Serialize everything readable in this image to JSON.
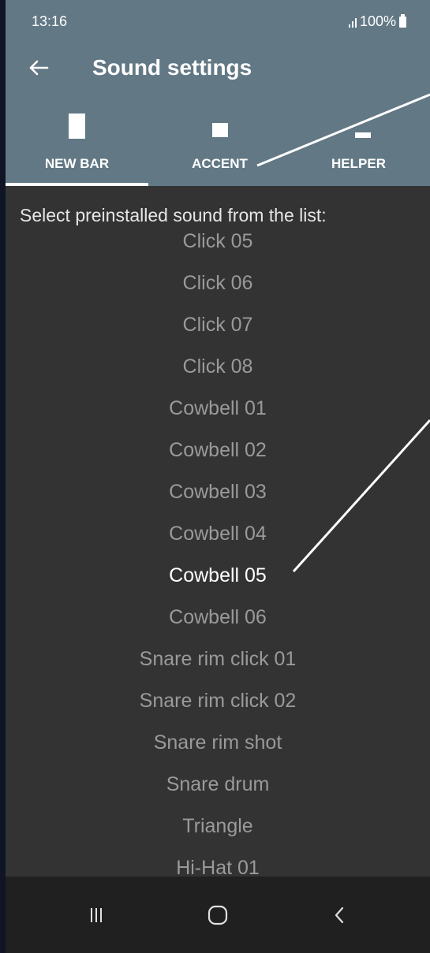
{
  "status_bar": {
    "time": "13:16",
    "battery": "100%"
  },
  "app_bar": {
    "title": "Sound settings",
    "back_icon": "arrow-left-icon"
  },
  "tabs": [
    {
      "label": "NEW BAR",
      "selected": true
    },
    {
      "label": "ACCENT",
      "selected": false
    },
    {
      "label": "HELPER",
      "selected": false
    }
  ],
  "content": {
    "heading": "Select preinstalled sound from the list:",
    "items": [
      "Click 05",
      "Click 06",
      "Click 07",
      "Click 08",
      "Cowbell 01",
      "Cowbell 02",
      "Cowbell 03",
      "Cowbell 04",
      "Cowbell 05",
      "Cowbell 06",
      "Snare rim click 01",
      "Snare rim click 02",
      "Snare rim shot",
      "Snare drum",
      "Triangle",
      "Hi-Hat 01"
    ],
    "selected_item": "Cowbell 05"
  },
  "nav_bar": {
    "recents_icon": "recents-icon",
    "home_icon": "home-icon",
    "back_icon": "nav-back-icon"
  },
  "colors": {
    "app_bar": "#627885",
    "background": "#333333",
    "nav_bar": "#202020",
    "item_text": "#9a9a9a",
    "selected_text": "#ffffff"
  }
}
